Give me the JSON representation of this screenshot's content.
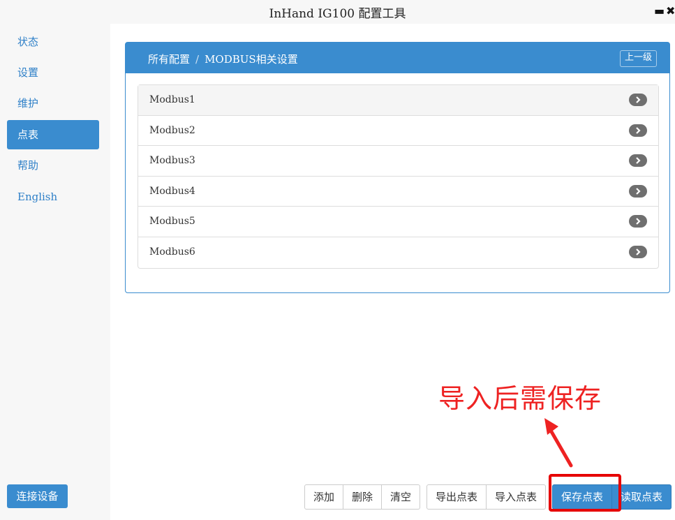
{
  "window": {
    "title": "InHand IG100 配置工具",
    "minimize_glyph": "▬",
    "close_glyph": "✖"
  },
  "sidebar": {
    "items": [
      {
        "label": "状态"
      },
      {
        "label": "设置"
      },
      {
        "label": "维护"
      },
      {
        "label": "点表",
        "active": true
      },
      {
        "label": "帮助"
      },
      {
        "label": "English"
      }
    ],
    "connect_label": "连接设备"
  },
  "panel": {
    "breadcrumb_root": "所有配置",
    "breadcrumb_sep": "/",
    "breadcrumb_current": "MODBUS相关设置",
    "up_label": "上一级",
    "items": [
      {
        "label": "Modbus1"
      },
      {
        "label": "Modbus2"
      },
      {
        "label": "Modbus3"
      },
      {
        "label": "Modbus4"
      },
      {
        "label": "Modbus5"
      },
      {
        "label": "Modbus6"
      }
    ]
  },
  "toolbar": {
    "add": "添加",
    "delete": "删除",
    "clear": "清空",
    "export": "导出点表",
    "import": "导入点表",
    "save": "保存点表",
    "read": "读取点表"
  },
  "annotation": {
    "text": "导入后需保存",
    "color": "#ee2222"
  },
  "colors": {
    "accent": "#3a8ccf",
    "annotation_red": "#e60000"
  }
}
